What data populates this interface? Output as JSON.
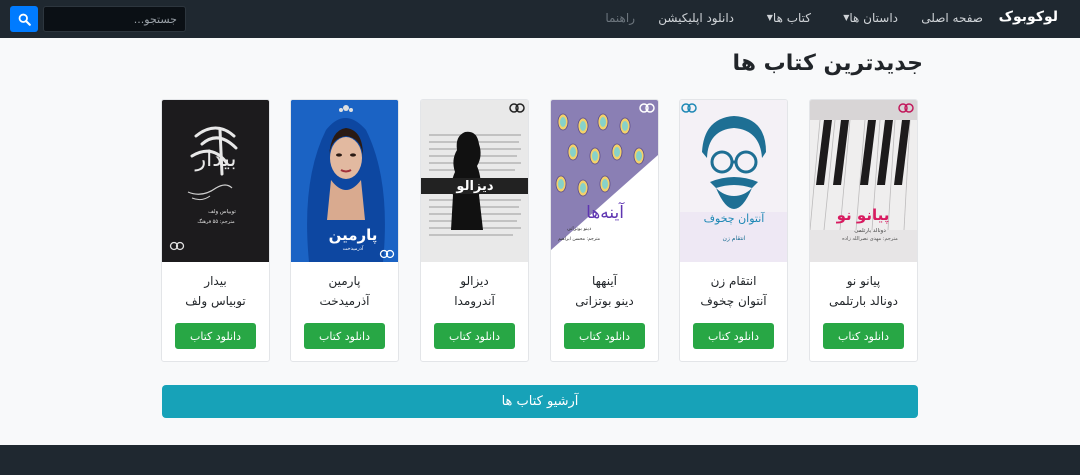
{
  "navbar": {
    "brand": "لوکوبوک",
    "items": [
      {
        "label": "صفحه اصلی",
        "dropdown": false,
        "disabled": false
      },
      {
        "label": "داستان ها",
        "dropdown": true,
        "disabled": false
      },
      {
        "label": "کتاب ها",
        "dropdown": true,
        "disabled": false
      },
      {
        "label": "دانلود اپلیکیشن",
        "dropdown": false,
        "disabled": false
      },
      {
        "label": "راهنما",
        "dropdown": false,
        "disabled": true
      }
    ],
    "search": {
      "placeholder": "جستجو...",
      "value": ""
    },
    "search_icon": "search-icon"
  },
  "main": {
    "title": "جدیدترین کتاب ها",
    "download_label": "دانلود کتاب",
    "books": [
      {
        "title": "پیانو نو",
        "author": "دونالد بارتلمی",
        "cover": {
          "big": "پیانو نو",
          "small": "دونالد بارتلمی",
          "translator": "مترجم: مهدی نصرالله زاده"
        }
      },
      {
        "title": "انتقام زن",
        "author": "آنتوان چخوف",
        "cover": {
          "big": "آنتوان چخوف",
          "small": "انتقام زن"
        }
      },
      {
        "title": "آینهها",
        "author": "دینو بوتزاتی",
        "cover": {
          "big": "آینه‌ها",
          "small": "دینو بوتزاتی",
          "translator": "مترجم: محسن ابراهیم"
        }
      },
      {
        "title": "دیزالو",
        "author": "آندرومدا",
        "cover": {
          "big": "دیزالو",
          "small": ""
        }
      },
      {
        "title": "پارمین",
        "author": "آذرمیدخت",
        "cover": {
          "big": "پارمین",
          "small": "آذرمیدخت"
        }
      },
      {
        "title": "بیدار",
        "author": "توبیاس ولف",
        "cover": {
          "big": "بیدار",
          "small": "توبیاس ولف",
          "translator": "مترجم: ۵۵ فرهنگ"
        }
      }
    ],
    "archive_label": "آرشیو کتاب ها"
  },
  "colors": {
    "navbar_bg": "#1f2830",
    "primary": "#007bff",
    "success": "#28a745",
    "info": "#17a2b8"
  }
}
